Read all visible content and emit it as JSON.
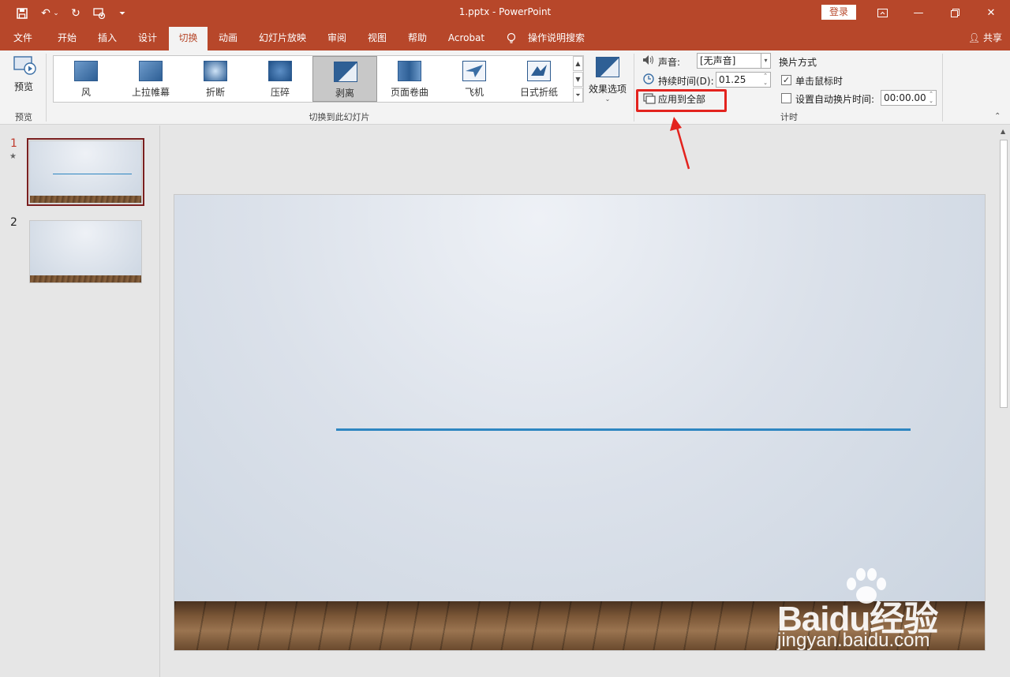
{
  "window": {
    "title": "1.pptx - PowerPoint",
    "login_label": "登录",
    "share_label": "共享"
  },
  "quick_access": {
    "icons": [
      "save-icon",
      "undo-icon",
      "redo-icon",
      "start-from-beginning-icon",
      "customize-icon"
    ]
  },
  "tabs": [
    {
      "label": "文件"
    },
    {
      "label": "开始"
    },
    {
      "label": "插入"
    },
    {
      "label": "设计"
    },
    {
      "label": "切换",
      "active": true
    },
    {
      "label": "动画"
    },
    {
      "label": "幻灯片放映"
    },
    {
      "label": "审阅"
    },
    {
      "label": "视图"
    },
    {
      "label": "帮助"
    },
    {
      "label": "Acrobat"
    },
    {
      "label": "操作说明搜索"
    }
  ],
  "ribbon": {
    "preview": {
      "button_label": "预览",
      "group_label": "预览"
    },
    "transitions": {
      "group_label": "切换到此幻灯片",
      "items": [
        {
          "label": "风"
        },
        {
          "label": "上拉帷幕"
        },
        {
          "label": "折断"
        },
        {
          "label": "压碎"
        },
        {
          "label": "剥离",
          "selected": true
        },
        {
          "label": "页面卷曲"
        },
        {
          "label": "飞机"
        },
        {
          "label": "日式折纸"
        }
      ],
      "effect_options_label": "效果选项"
    },
    "timing": {
      "group_label": "计时",
      "sound_label": "声音:",
      "sound_value": "[无声音]",
      "duration_label": "持续时间(D):",
      "duration_value": "01.25",
      "apply_all_label": "应用到全部",
      "advance_title": "换片方式",
      "on_click_label": "单击鼠标时",
      "on_click_checked": true,
      "auto_after_label": "设置自动换片时间:",
      "auto_after_checked": false,
      "auto_after_value": "00:00.00"
    }
  },
  "slides": [
    {
      "number": "1",
      "marker": "★",
      "selected": true
    },
    {
      "number": "2",
      "selected": false
    }
  ],
  "watermark": {
    "brand": "Baidu经验",
    "url": "jingyan.baidu.com"
  },
  "colors": {
    "accent": "#b7472a",
    "highlight": "#e3231e",
    "slide_line": "#2e86c1"
  }
}
